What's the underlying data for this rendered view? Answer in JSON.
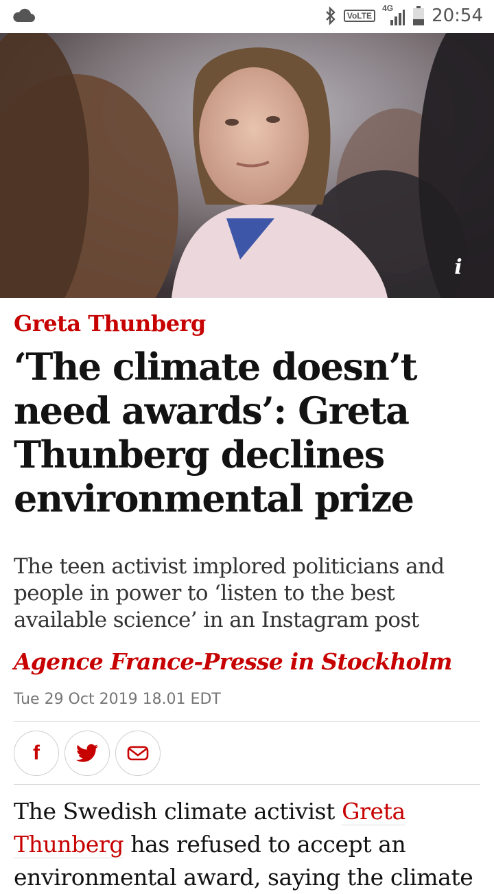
{
  "status_bar": {
    "time": "20:54",
    "volte": "VoLTE",
    "network": "4G",
    "icons": [
      "cloud-icon",
      "bluetooth-icon",
      "signal-icon",
      "battery-icon"
    ]
  },
  "hero": {
    "info_label": "i"
  },
  "article": {
    "kicker": "Greta Thunberg",
    "headline": "‘The climate doesn’t need awards’: Greta Thunberg declines environmental prize",
    "standfirst": "The teen activist implored politicians and people in power to ‘listen to the best available science’ in an Instagram post",
    "byline": "Agence France-Presse in Stockholm",
    "dateline": "Tue 29 Oct 2019 18.01 EDT",
    "share": {
      "icons": [
        "facebook-icon",
        "twitter-icon",
        "email-icon"
      ],
      "facebook_glyph": "f"
    },
    "body": {
      "before_link": "The Swedish climate activist ",
      "link_text": "Greta Thunberg",
      "after_link": " has refused to accept an environmental award, saying the climate"
    }
  },
  "colors": {
    "accent": "#c70000",
    "text": "#121212",
    "muted": "#767676",
    "divider": "#dcdcdc"
  }
}
